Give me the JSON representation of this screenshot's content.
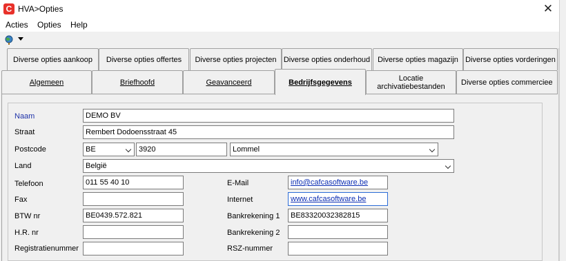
{
  "window": {
    "title": "HVA>Opties",
    "app_icon_letter": "C"
  },
  "menu": {
    "items": [
      "Acties",
      "Opties",
      "Help"
    ]
  },
  "tabs": {
    "row1": [
      "Diverse opties aankoop",
      "Diverse opties offertes",
      "Diverse opties projecten",
      "Diverse opties onderhoud",
      "Diverse opties magazijn",
      "Diverse opties vorderingen"
    ],
    "row2": [
      "Algemeen",
      "Briefhoofd",
      "Geavanceerd",
      "Bedrijfsgegevens",
      "Locatie archivatiebestanden",
      "Diverse opties commerciee"
    ],
    "active": "Bedrijfsgegevens"
  },
  "form": {
    "naam": {
      "label": "Naam",
      "value": "DEMO BV"
    },
    "straat": {
      "label": "Straat",
      "value": "Rembert Dodoensstraat 45"
    },
    "postcode": {
      "label": "Postcode",
      "country_code": "BE",
      "zip": "3920",
      "city": "Lommel"
    },
    "land": {
      "label": "Land",
      "value": "België"
    },
    "telefoon": {
      "label": "Telefoon",
      "value": "011 55 40 10"
    },
    "fax": {
      "label": "Fax",
      "value": ""
    },
    "btw": {
      "label": "BTW nr",
      "value": "BE0439.572.821"
    },
    "hr": {
      "label": "H.R. nr",
      "value": ""
    },
    "registratie": {
      "label": "Registratienummer",
      "value": ""
    },
    "email": {
      "label": "E-Mail",
      "value": "info@cafcasoftware.be"
    },
    "internet": {
      "label": "Internet",
      "value": "www.cafcasoftware.be"
    },
    "bank1": {
      "label": "Bankrekening 1",
      "value": "BE83320032382815"
    },
    "bank2": {
      "label": "Bankrekening 2",
      "value": ""
    },
    "rsz": {
      "label": "RSZ-nummer",
      "value": ""
    }
  },
  "colors": {
    "accent": "#e8312a",
    "label_blue": "#1e32a8",
    "link": "#0b2db3"
  }
}
